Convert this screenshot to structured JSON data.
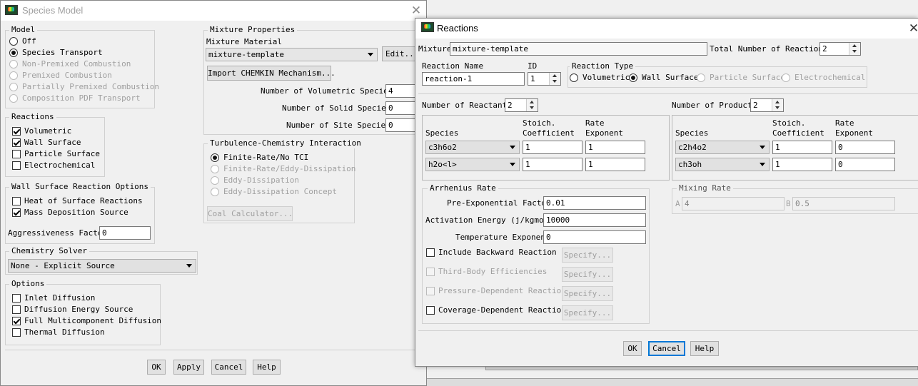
{
  "species_model": {
    "title": "Species Model",
    "model": {
      "caption": "Model",
      "options": [
        {
          "label": "Off",
          "selected": false,
          "enabled": true
        },
        {
          "label": "Species Transport",
          "selected": true,
          "enabled": true
        },
        {
          "label": "Non-Premixed Combustion",
          "selected": false,
          "enabled": false
        },
        {
          "label": "Premixed Combustion",
          "selected": false,
          "enabled": false
        },
        {
          "label": "Partially Premixed Combustion",
          "selected": false,
          "enabled": false
        },
        {
          "label": "Composition PDF Transport",
          "selected": false,
          "enabled": false
        }
      ]
    },
    "reactions": {
      "caption": "Reactions",
      "options": [
        {
          "label": "Volumetric",
          "checked": true
        },
        {
          "label": "Wall Surface",
          "checked": true
        },
        {
          "label": "Particle Surface",
          "checked": false
        },
        {
          "label": "Electrochemical",
          "checked": false
        }
      ]
    },
    "wall_surface": {
      "caption": "Wall Surface Reaction Options",
      "options": [
        {
          "label": "Heat of Surface Reactions",
          "checked": false
        },
        {
          "label": "Mass Deposition Source",
          "checked": true
        }
      ],
      "aggressiveness_label": "Aggressiveness Factor",
      "aggressiveness_value": "0"
    },
    "chemistry_solver": {
      "caption": "Chemistry Solver",
      "value": "None - Explicit Source"
    },
    "options": {
      "caption": "Options",
      "items": [
        {
          "label": "Inlet Diffusion",
          "checked": false
        },
        {
          "label": "Diffusion Energy Source",
          "checked": false
        },
        {
          "label": "Full Multicomponent Diffusion",
          "checked": true
        },
        {
          "label": "Thermal Diffusion",
          "checked": false
        }
      ]
    },
    "mixture": {
      "caption": "Mixture Properties",
      "material_label": "Mixture Material",
      "material_value": "mixture-template",
      "edit_button": "Edit...",
      "import_button": "Import CHEMKIN Mechanism...",
      "volumetric_label": "Number of Volumetric Species",
      "volumetric_value": "4",
      "solid_label": "Number of Solid Species",
      "solid_value": "0",
      "site_label": "Number of Site Species",
      "site_value": "0"
    },
    "turbulence": {
      "caption": "Turbulence-Chemistry Interaction",
      "options": [
        {
          "label": "Finite-Rate/No TCI",
          "selected": true,
          "enabled": true
        },
        {
          "label": "Finite-Rate/Eddy-Dissipation",
          "selected": false,
          "enabled": false
        },
        {
          "label": "Eddy-Dissipation",
          "selected": false,
          "enabled": false
        },
        {
          "label": "Eddy-Dissipation Concept",
          "selected": false,
          "enabled": false
        }
      ],
      "coal_button": "Coal Calculator..."
    },
    "buttons": {
      "ok": "OK",
      "apply": "Apply",
      "cancel": "Cancel",
      "help": "Help"
    }
  },
  "reactions_dialog": {
    "title": "Reactions",
    "mixture_label": "Mixture",
    "mixture_value": "mixture-template",
    "total_label": "Total Number of Reactions",
    "total_value": "2",
    "name_label": "Reaction Name",
    "name_value": "reaction-1",
    "id_label": "ID",
    "id_value": "1",
    "type": {
      "caption": "Reaction Type",
      "options": [
        {
          "label": "Volumetric",
          "selected": false,
          "enabled": true
        },
        {
          "label": "Wall Surface",
          "selected": true,
          "enabled": true
        },
        {
          "label": "Particle Surface",
          "selected": false,
          "enabled": false
        },
        {
          "label": "Electrochemical",
          "selected": false,
          "enabled": false
        }
      ]
    },
    "reactants": {
      "count_label": "Number of Reactants",
      "count_value": "2",
      "col_species": "Species",
      "col_stoich_1": "Stoich.",
      "col_stoich_2": "Coefficient",
      "col_rate_1": "Rate",
      "col_rate_2": "Exponent",
      "rows": [
        {
          "species": "c3h6o2",
          "stoich": "1",
          "rate": "1"
        },
        {
          "species": "h2o<l>",
          "stoich": "1",
          "rate": "1"
        }
      ]
    },
    "products": {
      "count_label": "Number of Products",
      "count_value": "2",
      "col_species": "Species",
      "col_stoich_1": "Stoich.",
      "col_stoich_2": "Coefficient",
      "col_rate_1": "Rate",
      "col_rate_2": "Exponent",
      "rows": [
        {
          "species": "c2h4o2",
          "stoich": "1",
          "rate": "0"
        },
        {
          "species": "ch3oh",
          "stoich": "1",
          "rate": "0"
        }
      ]
    },
    "arrhenius": {
      "caption": "Arrhenius Rate",
      "pre_exp_label": "Pre-Exponential Factor",
      "pre_exp_value": "0.01",
      "activation_label": "Activation Energy (j/kgmol)",
      "activation_value": "10000",
      "temp_label": "Temperature Exponent",
      "temp_value": "0",
      "checks": [
        {
          "label": "Include Backward Reaction",
          "checked": false,
          "enabled": true,
          "button": "Specify..."
        },
        {
          "label": "Third-Body Efficiencies",
          "checked": false,
          "enabled": false,
          "button": "Specify..."
        },
        {
          "label": "Pressure-Dependent Reaction",
          "checked": false,
          "enabled": false,
          "button": "Specify..."
        },
        {
          "label": "Coverage-Dependent Reaction",
          "checked": false,
          "enabled": true,
          "button": "Specify..."
        }
      ]
    },
    "mixing": {
      "caption": "Mixing Rate",
      "a_label": "A",
      "a_value": "4",
      "b_label": "B",
      "b_value": "0.5"
    },
    "buttons": {
      "ok": "OK",
      "cancel": "Cancel",
      "help": "Help"
    }
  }
}
